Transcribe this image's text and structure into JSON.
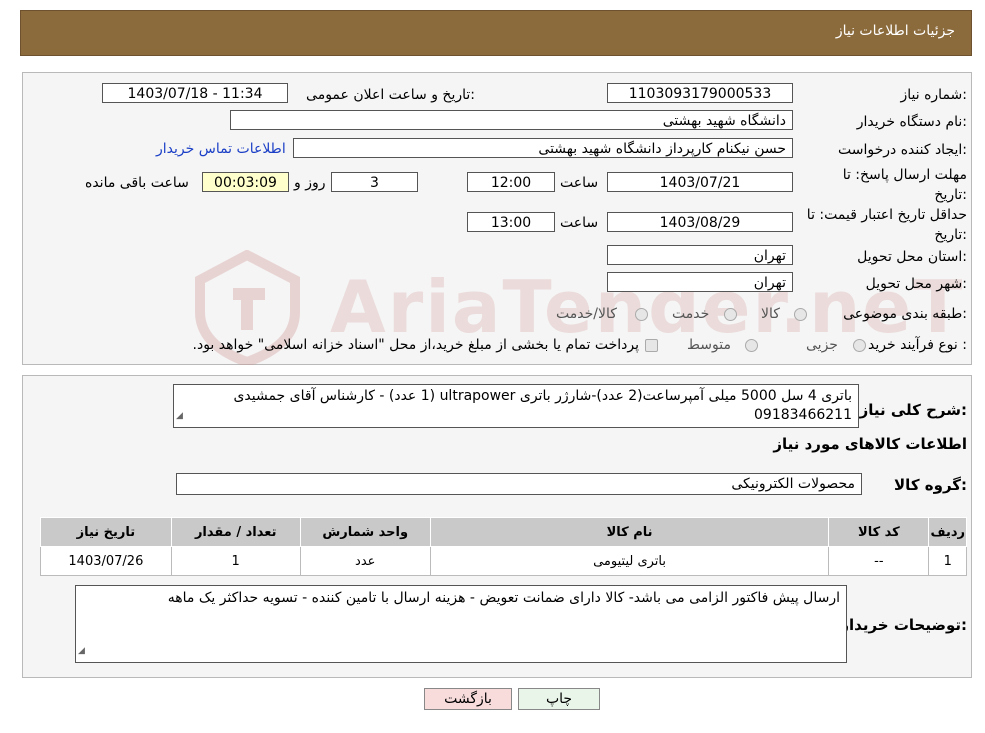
{
  "header": {
    "title": "جزئیات اطلاعات نیاز"
  },
  "watermark": {
    "text": "AriaTender.neT"
  },
  "form": {
    "need_number_label": "شماره نیاز:",
    "need_number": "1103093179000533",
    "announce_label": "تاریخ و ساعت اعلان عمومی:",
    "announce_value": "1403/07/18 - 11:34",
    "buyer_label": "نام دستگاه خریدار:",
    "buyer_value": "دانشگاه شهید بهشتی",
    "requester_label": "ایجاد کننده درخواست:",
    "requester_value": "حسن نیکنام کارپرداز دانشگاه شهید بهشتی",
    "contact_link": "اطلاعات تماس خریدار",
    "reply_deadline_label": "مهلت ارسال پاسخ: تا تاریخ:",
    "reply_date": "1403/07/21",
    "time_label": "ساعت",
    "reply_time": "12:00",
    "days_value": "3",
    "days_label": "روز و",
    "remaining_value": "00:03:09",
    "remaining_label": "ساعت باقی مانده",
    "price_validity_label": "حداقل تاریخ اعتبار قیمت: تا تاریخ:",
    "price_date": "1403/08/29",
    "price_time": "13:00",
    "province_label": "استان محل تحویل:",
    "province_value": "تهران",
    "city_label": "شهر محل تحویل:",
    "city_value": "تهران",
    "category_label": "طبقه بندی موضوعی:",
    "category_options": [
      "کالا",
      "خدمت",
      "کالا/خدمت"
    ],
    "process_label": "نوع فرآیند خرید :",
    "process_options": [
      "جزیی",
      "متوسط"
    ],
    "process_note": "پرداخت تمام یا بخشی از مبلغ خرید،از محل \"اسناد خزانه اسلامی\" خواهد بود."
  },
  "details": {
    "description_label": "شرح کلی نیاز:",
    "description_value": "باتری 4 سل 5000 میلی آمپرساعت(2 عدد)-شارژر باتری ultrapower (1 عدد) - کارشناس آقای جمشیدی 09183466211",
    "goods_info_title": "اطلاعات کالاهای مورد نیاز",
    "goods_group_label": "گروه کالا:",
    "goods_group_value": "محصولات الکترونیکی",
    "table": {
      "headers": [
        "ردیف",
        "کد کالا",
        "نام کالا",
        "واحد شمارش",
        "تعداد / مقدار",
        "تاریخ نیاز"
      ],
      "rows": [
        [
          "1",
          "--",
          "باتری لیتیومی",
          "عدد",
          "1",
          "1403/07/26"
        ]
      ]
    },
    "buyer_notes_label": "توضیحات خریدار:",
    "buyer_notes_value": "ارسال پیش فاکتور الزامی می باشد- کالا دارای ضمانت تعویض - هزینه ارسال با تامین کننده - تسویه حداکثر یک ماهه"
  },
  "buttons": {
    "print": "چاپ",
    "back": "بازگشت"
  },
  "colors": {
    "header_bg": "#8b6a3c",
    "back_button_bg": "#f8dcdc",
    "print_button_bg": "#eaf5ea",
    "link": "#1b3fc6"
  }
}
